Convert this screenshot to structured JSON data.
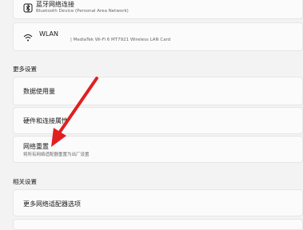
{
  "bluetooth": {
    "title": "蓝牙网络连接",
    "subtitle": "Bluetooth Device (Personal Area Network)"
  },
  "wlan": {
    "title": "WLAN",
    "subtitle": "| MediaTek Wi-Fi 6 MT7921 Wireless LAN Card"
  },
  "more_settings": {
    "heading": "更多设置",
    "items": [
      {
        "label": "数据使用量"
      },
      {
        "label": "硬件和连接属性"
      },
      {
        "label": "网络重置",
        "description": "将所有网络适配器重置为出厂设置"
      }
    ]
  },
  "related_settings": {
    "heading": "相关设置",
    "items": [
      {
        "label": "更多网络适配器选项"
      }
    ]
  },
  "colors": {
    "annotation_arrow": "#e02020"
  }
}
